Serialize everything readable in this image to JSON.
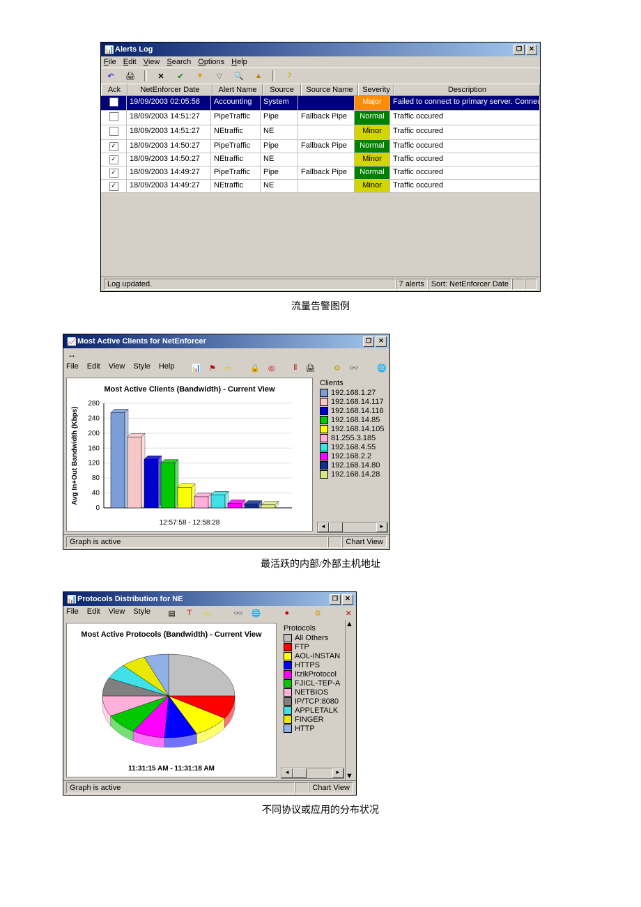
{
  "alerts_window": {
    "title": "Alerts Log",
    "menu": {
      "file": "File",
      "edit": "Edit",
      "view": "View",
      "search": "Search",
      "options": "Options",
      "help": "Help"
    },
    "columns": {
      "ack": "Ack",
      "date": "NetEnforcer Date",
      "alert": "Alert Name",
      "source": "Source",
      "sname": "Source Name",
      "sev": "Severity",
      "desc": "Description"
    },
    "rows": [
      {
        "ack": "",
        "date": "19/09/2003 02:05:58",
        "alert": "Accounting",
        "source": "System",
        "sname": "",
        "sev": "Major",
        "sevcls": "sev-major",
        "desc": "Failed to connect to primary server. Connecting to seco..."
      },
      {
        "ack": "",
        "date": "18/09/2003 14:51:27",
        "alert": "PipeTraffic",
        "source": "Pipe",
        "sname": "Fallback Pipe",
        "sev": "Normal",
        "sevcls": "sev-normal",
        "desc": "Traffic occured"
      },
      {
        "ack": "",
        "date": "18/09/2003 14:51:27",
        "alert": "NEtraffic",
        "source": "NE",
        "sname": "",
        "sev": "Minor",
        "sevcls": "sev-minor",
        "desc": "Traffic occured"
      },
      {
        "ack": "✓",
        "date": "18/09/2003 14:50:27",
        "alert": "PipeTraffic",
        "source": "Pipe",
        "sname": "Fallback Pipe",
        "sev": "Normal",
        "sevcls": "sev-normal",
        "desc": "Traffic occured"
      },
      {
        "ack": "✓",
        "date": "18/09/2003 14:50:27",
        "alert": "NEtraffic",
        "source": "NE",
        "sname": "",
        "sev": "Minor",
        "sevcls": "sev-minor",
        "desc": "Traffic occured"
      },
      {
        "ack": "✓",
        "date": "18/09/2003 14:49:27",
        "alert": "PipeTraffic",
        "source": "Pipe",
        "sname": "Fallback Pipe",
        "sev": "Normal",
        "sevcls": "sev-normal",
        "desc": "Traffic occured"
      },
      {
        "ack": "✓",
        "date": "18/09/2003 14:49:27",
        "alert": "NEtraffic",
        "source": "NE",
        "sname": "",
        "sev": "Minor",
        "sevcls": "sev-minor",
        "desc": "Traffic occured"
      }
    ],
    "status_left": "Log updated.",
    "status_count": "7 alerts",
    "status_sort": "Sort: NetEnforcer Date"
  },
  "caption1": "流量告警图例",
  "clients_window": {
    "title": "Most Active Clients for NetEnforcer",
    "menu": {
      "file": "File",
      "edit": "Edit",
      "view": "View",
      "style": "Style",
      "help": "Help"
    },
    "chart_title": "Most Active Clients (Bandwidth) - Current View",
    "ylabel": "Avg In+Out Bandwidth (Kbps)",
    "xlabel": "12:57:58 - 12:58:28",
    "legend_title": "Clients",
    "status_left": "Graph is active",
    "status_right": "Chart View"
  },
  "caption2": "最活跃的内部/外部主机地址",
  "protocols_window": {
    "title": "Protocols Distribution for NE",
    "menu": {
      "file": "File",
      "edit": "Edit",
      "view": "View",
      "style": "Style"
    },
    "chart_title": "Most Active Protocols (Bandwidth) - Current View",
    "xlabel": "11:31:15 AM - 11:31:18 AM",
    "legend_title": "Protocols",
    "status_left": "Graph is active",
    "status_right": "Chart View"
  },
  "caption3": "不同协议或应用的分布状况",
  "chart_data": [
    {
      "type": "bar",
      "title": "Most Active Clients (Bandwidth) - Current View",
      "ylabel": "Avg In+Out Bandwidth (Kbps)",
      "xlabel": "12:57:58 - 12:58:28",
      "yticks": [
        0,
        40,
        80,
        120,
        160,
        200,
        240,
        280
      ],
      "ylim": [
        0,
        280
      ],
      "series": [
        {
          "name": "192.168.1.27",
          "value": 255,
          "color": "#7b9ed8"
        },
        {
          "name": "192.168.14.117",
          "value": 190,
          "color": "#f7c7c7"
        },
        {
          "name": "192.168.14.116",
          "value": 130,
          "color": "#0000cc"
        },
        {
          "name": "192.168.14.85",
          "value": 120,
          "color": "#00c800"
        },
        {
          "name": "192.168.14.105",
          "value": 55,
          "color": "#ffff00"
        },
        {
          "name": "81.255.3.185",
          "value": 30,
          "color": "#ffb0d8"
        },
        {
          "name": "192.168.4.55",
          "value": 35,
          "color": "#40e0e8"
        },
        {
          "name": "192.168.2.2",
          "value": 12,
          "color": "#ff00ff"
        },
        {
          "name": "192.168.14.80",
          "value": 10,
          "color": "#103090"
        },
        {
          "name": "192.168.14.28",
          "value": 8,
          "color": "#d8e880"
        }
      ]
    },
    {
      "type": "pie",
      "title": "Most Active Protocols (Bandwidth) - Current View",
      "xlabel": "11:31:15 AM - 11:31:18 AM",
      "series": [
        {
          "name": "All Others",
          "value": 25,
          "color": "#c0c0c0"
        },
        {
          "name": "FTP",
          "value": 9,
          "color": "#ff0000"
        },
        {
          "name": "AOL-INSTAN",
          "value": 9,
          "color": "#ffff00"
        },
        {
          "name": "HTTPS",
          "value": 8,
          "color": "#0000ff"
        },
        {
          "name": "ItzikProtocol",
          "value": 8,
          "color": "#ff00ff"
        },
        {
          "name": "FJICL-TEP-A",
          "value": 8,
          "color": "#00c800"
        },
        {
          "name": "NETBIOS",
          "value": 8,
          "color": "#ffb0d8"
        },
        {
          "name": "IP/TCP:8080",
          "value": 7,
          "color": "#808080"
        },
        {
          "name": "APPLETALK",
          "value": 6,
          "color": "#40e0e8"
        },
        {
          "name": "FINGER",
          "value": 6,
          "color": "#e8e800"
        },
        {
          "name": "HTTP",
          "value": 6,
          "color": "#90b0e8"
        }
      ]
    }
  ]
}
